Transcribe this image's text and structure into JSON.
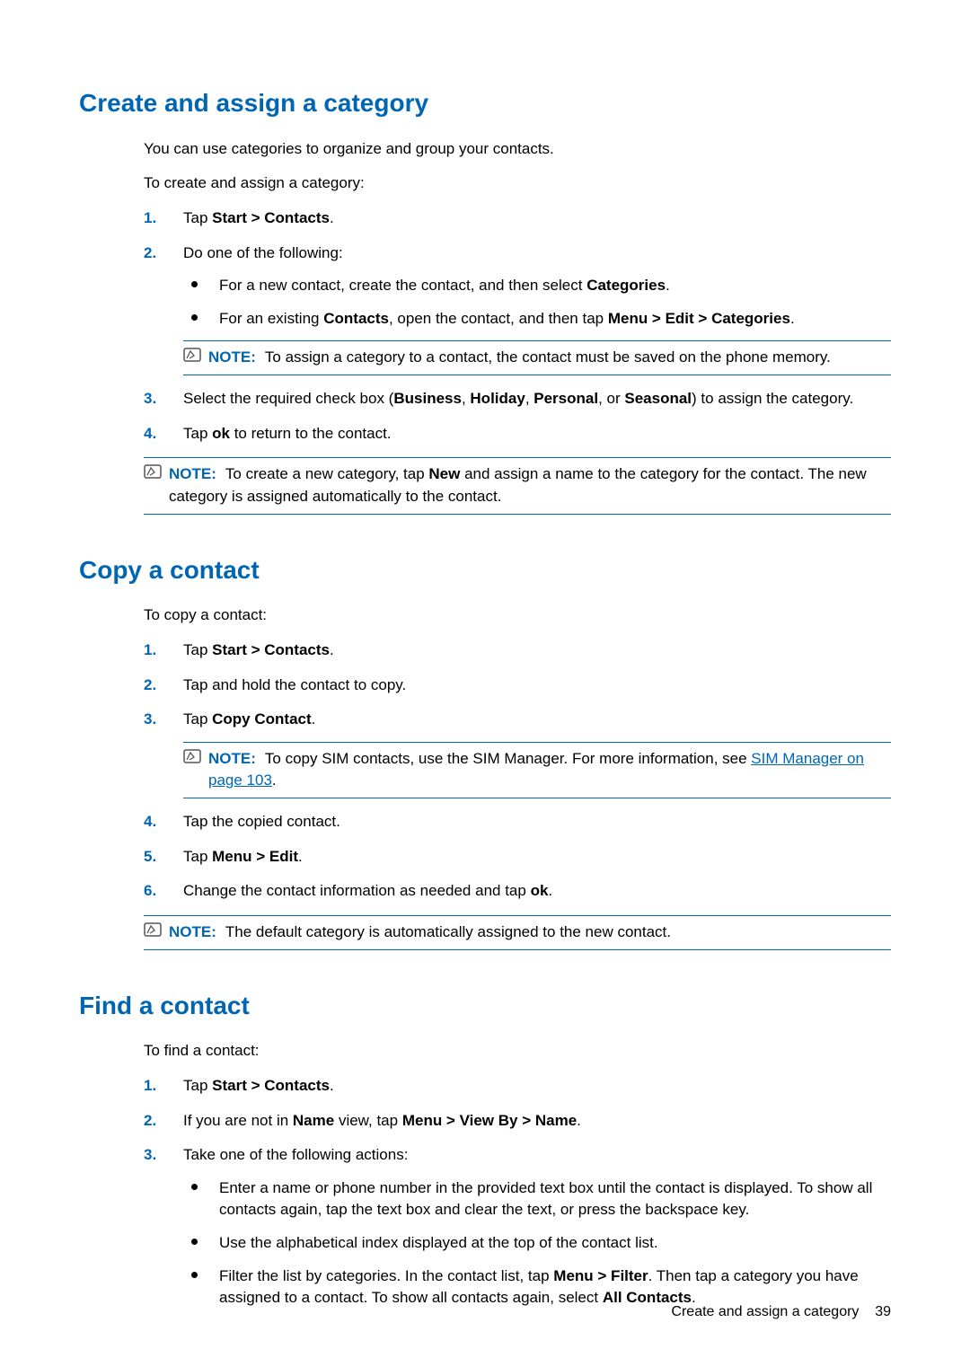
{
  "colors": {
    "accent": "#0066b3"
  },
  "note_label": "NOTE:",
  "step_numbers": [
    "1.",
    "2.",
    "3.",
    "4.",
    "5.",
    "6."
  ],
  "section1": {
    "heading": "Create and assign a category",
    "intro1": "You can use categories to organize and group your contacts.",
    "intro2": "To create and assign a category:",
    "step1_a": "Tap ",
    "step1_b": "Start > Contacts",
    "step1_c": ".",
    "step2": "Do one of the following:",
    "step2_b1_a": "For a new contact, create the contact, and then select ",
    "step2_b1_b": "Categories",
    "step2_b1_c": ".",
    "step2_b2_a": "For an existing ",
    "step2_b2_b": "Contacts",
    "step2_b2_c": ", open the contact, and then tap ",
    "step2_b2_d": "Menu > Edit > Categories",
    "step2_b2_e": ".",
    "step2_note": "To assign a category to a contact, the contact must be saved on the phone memory.",
    "step3_a": "Select the required check box (",
    "step3_b": "Business",
    "step3_c": ", ",
    "step3_d": "Holiday",
    "step3_e": ", ",
    "step3_f": "Personal",
    "step3_g": ", or ",
    "step3_h": "Seasonal",
    "step3_i": ") to assign the category.",
    "step4_a": "Tap ",
    "step4_b": "ok",
    "step4_c": " to return to the contact.",
    "end_note_a": "To create a new category, tap ",
    "end_note_b": "New",
    "end_note_c": " and assign a name to the category for the contact. The new category is assigned automatically to the contact."
  },
  "section2": {
    "heading": "Copy a contact",
    "intro": "To copy a contact:",
    "step1_a": "Tap ",
    "step1_b": "Start > Contacts",
    "step1_c": ".",
    "step2": "Tap and hold the contact to copy.",
    "step3_a": "Tap ",
    "step3_b": "Copy Contact",
    "step3_c": ".",
    "step3_note_a": "To copy SIM contacts, use the SIM Manager. For more information, see ",
    "step3_note_link": "SIM Manager on page 103",
    "step3_note_c": ".",
    "step4": "Tap the copied contact.",
    "step5_a": "Tap ",
    "step5_b": "Menu > Edit",
    "step5_c": ".",
    "step6_a": "Change the contact information as needed and tap ",
    "step6_b": "ok",
    "step6_c": ".",
    "end_note": "The default category is automatically assigned to the new contact."
  },
  "section3": {
    "heading": "Find a contact",
    "intro": "To find a contact:",
    "step1_a": "Tap ",
    "step1_b": "Start > Contacts",
    "step1_c": ".",
    "step2_a": "If you are not in ",
    "step2_b": "Name",
    "step2_c": " view, tap ",
    "step2_d": "Menu > View By > Name",
    "step2_e": ".",
    "step3": "Take one of the following actions:",
    "step3_b1": "Enter a name or phone number in the provided text box until the contact is displayed. To show all contacts again, tap the text box and clear the text, or press the backspace key.",
    "step3_b2": "Use the alphabetical index displayed at the top of the contact list.",
    "step3_b3_a": "Filter the list by categories. In the contact list, tap ",
    "step3_b3_b": "Menu > Filter",
    "step3_b3_c": ". Then tap a category you have assigned to a contact. To show all contacts again, select ",
    "step3_b3_d": "All Contacts",
    "step3_b3_e": "."
  },
  "footer": {
    "text": "Create and assign a category",
    "page": "39"
  }
}
